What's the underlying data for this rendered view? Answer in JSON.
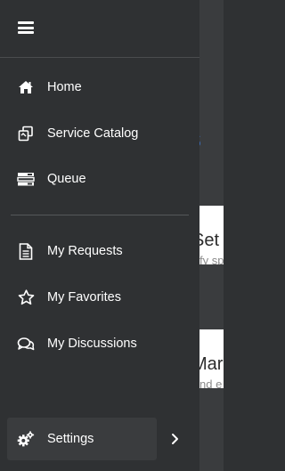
{
  "drawer": {
    "menu_icon": "hamburger-menu-icon",
    "items": [
      {
        "label": "Home",
        "icon": "home-icon"
      },
      {
        "label": "Service Catalog",
        "icon": "catalog-icon"
      },
      {
        "label": "Queue",
        "icon": "queue-icon"
      },
      {
        "label": "My Requests",
        "icon": "document-icon"
      },
      {
        "label": "My Favorites",
        "icon": "star-icon"
      },
      {
        "label": "My Discussions",
        "icon": "discussions-icon"
      }
    ],
    "settings": {
      "label": "Settings",
      "icon": "gear-icon",
      "expand_icon": "chevron-right-icon"
    }
  },
  "background_page": {
    "heading_fragment": "s",
    "card1": {
      "title_fragment": "Set",
      "sub_fragment": "fy sp"
    },
    "card2": {
      "title_fragment": "Mar",
      "sub_fragment": "nd e"
    }
  },
  "colors": {
    "drawer_bg": "#2f3133",
    "text": "#ffffff",
    "accent": "#3c6db8"
  }
}
